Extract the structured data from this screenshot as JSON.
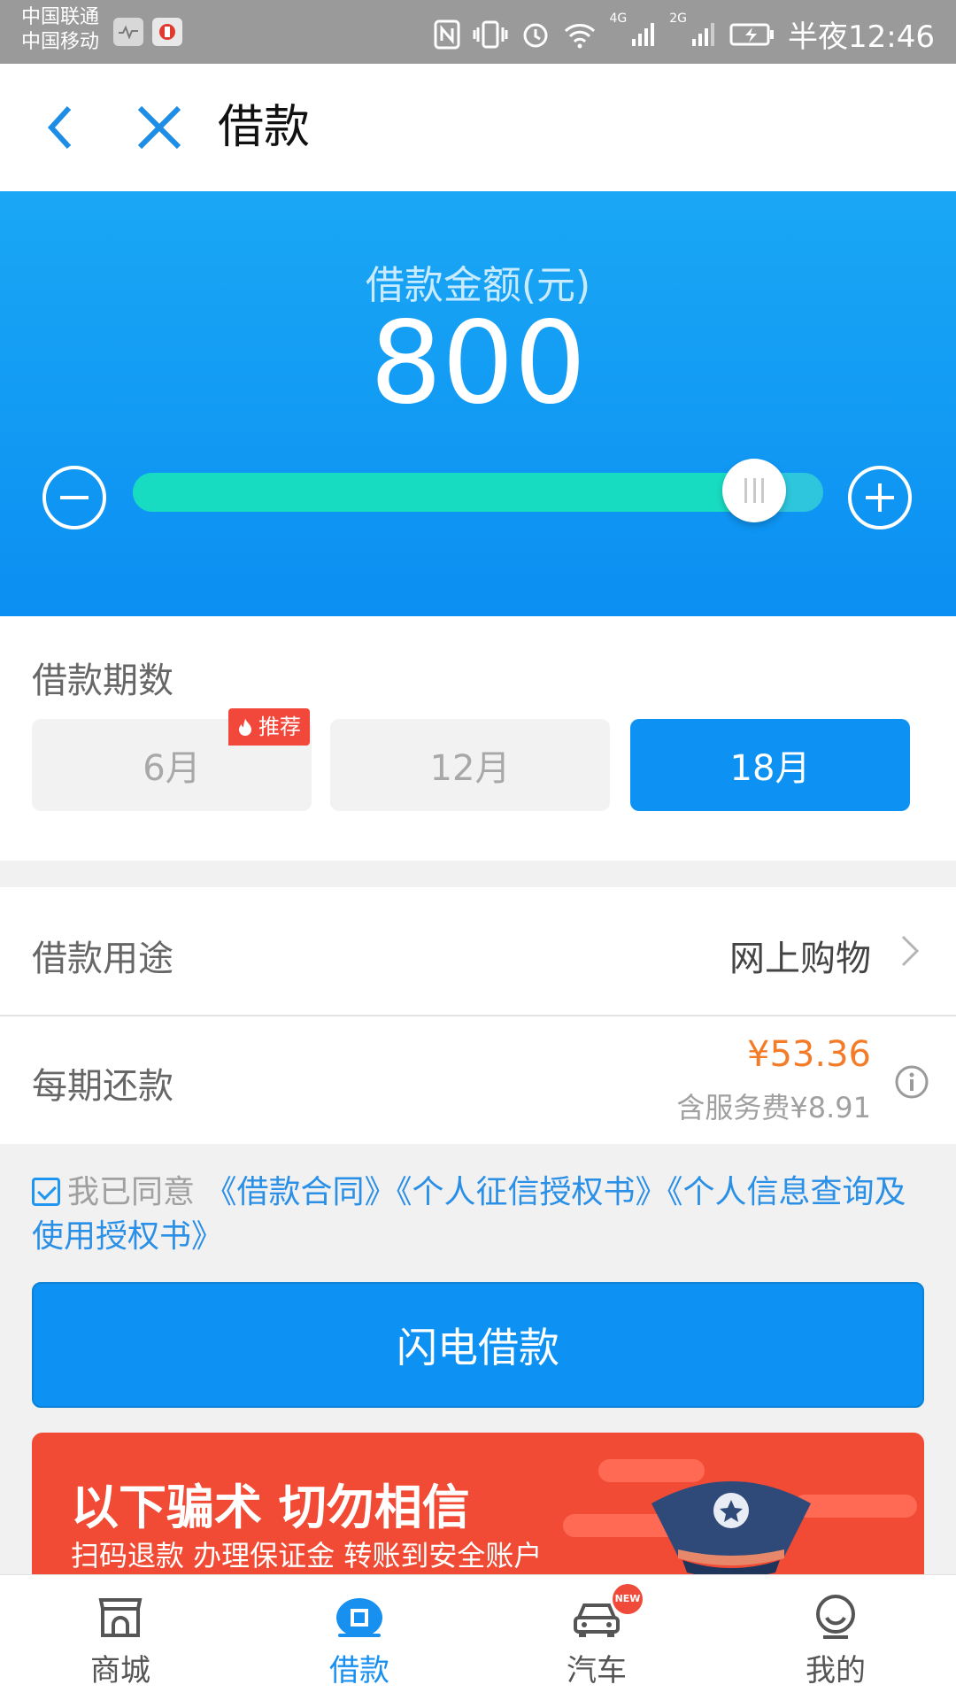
{
  "status_bar": {
    "carrier_1": "中国联通",
    "carrier_2": "中国移动",
    "net_4g": "4G",
    "net_2g": "2G",
    "time": "半夜12:46"
  },
  "nav": {
    "title": "借款"
  },
  "loan": {
    "amount_label": "借款金额(元)",
    "amount": "800",
    "slider_fraction": 0.9
  },
  "term": {
    "title": "借款期数",
    "options": [
      {
        "label": "6月",
        "badge": "推荐",
        "selected": false
      },
      {
        "label": "12月",
        "selected": false
      },
      {
        "label": "18月",
        "selected": true
      }
    ]
  },
  "purpose": {
    "label": "借款用途",
    "value": "网上购物"
  },
  "repayment": {
    "label": "每期还款",
    "amount": "¥53.36",
    "fee": "含服务费¥8.91"
  },
  "agreement": {
    "prefix": "我已同意",
    "links": [
      "《借款合同》",
      "《个人征信授权书》",
      "《个人信息查询及使用授权书》"
    ]
  },
  "submit": {
    "label": "闪电借款"
  },
  "banner": {
    "title": "以下骗术 切勿相信",
    "subtitle": "扫码退款 办理保证金 转账到安全账户"
  },
  "tabs": [
    {
      "label": "商城",
      "icon": "store-icon",
      "active": false
    },
    {
      "label": "借款",
      "icon": "loan-icon",
      "active": true
    },
    {
      "label": "汽车",
      "icon": "car-icon",
      "badge": "NEW",
      "active": false
    },
    {
      "label": "我的",
      "icon": "profile-icon",
      "active": false
    }
  ],
  "colors": {
    "primary": "#0d92f3",
    "slider_fill": "#17dcc1",
    "repay_amount": "#f47b28",
    "badge": "#f2473b",
    "banner": "#f14b35"
  }
}
